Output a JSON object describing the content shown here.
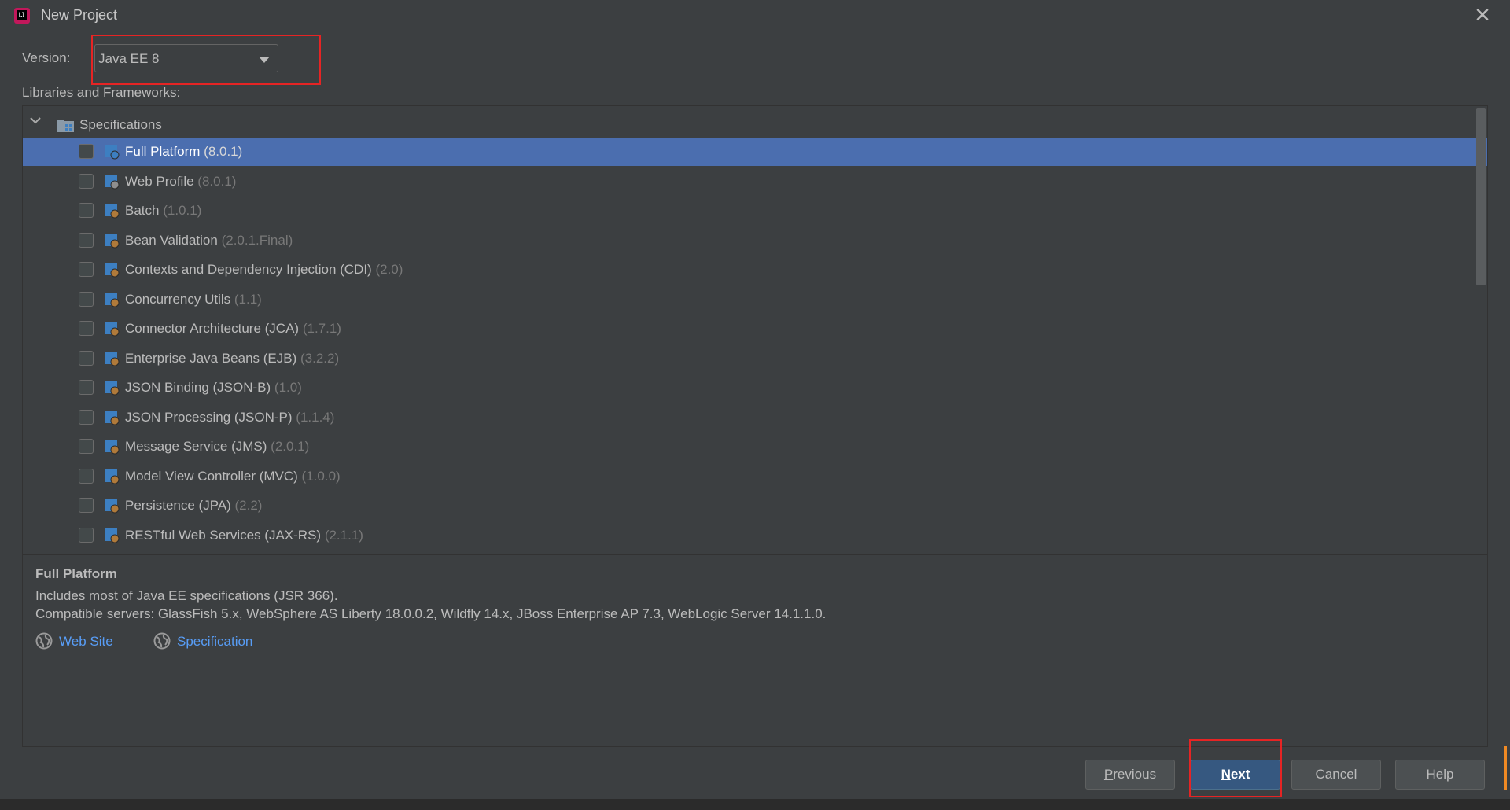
{
  "window": {
    "title": "New Project",
    "close_glyph": "✕"
  },
  "version": {
    "label": "Version:",
    "value": "Java EE 8"
  },
  "libraries": {
    "label": "Libraries and Frameworks:",
    "root_label": "Specifications",
    "items": [
      {
        "name": "Full Platform",
        "version": "(8.0.1)",
        "selected": true,
        "checked": false
      },
      {
        "name": "Web Profile",
        "version": "(8.0.1)",
        "selected": false,
        "checked": false
      },
      {
        "name": "Batch",
        "version": "(1.0.1)",
        "selected": false,
        "checked": false
      },
      {
        "name": "Bean Validation",
        "version": "(2.0.1.Final)",
        "selected": false,
        "checked": false
      },
      {
        "name": "Contexts and Dependency Injection (CDI)",
        "version": "(2.0)",
        "selected": false,
        "checked": false
      },
      {
        "name": "Concurrency Utils",
        "version": "(1.1)",
        "selected": false,
        "checked": false
      },
      {
        "name": "Connector Architecture (JCA)",
        "version": "(1.7.1)",
        "selected": false,
        "checked": false
      },
      {
        "name": "Enterprise Java Beans (EJB)",
        "version": "(3.2.2)",
        "selected": false,
        "checked": false
      },
      {
        "name": "JSON Binding (JSON-B)",
        "version": "(1.0)",
        "selected": false,
        "checked": false
      },
      {
        "name": "JSON Processing (JSON-P)",
        "version": "(1.1.4)",
        "selected": false,
        "checked": false
      },
      {
        "name": "Message Service (JMS)",
        "version": "(2.0.1)",
        "selected": false,
        "checked": false
      },
      {
        "name": "Model View Controller (MVC)",
        "version": "(1.0.0)",
        "selected": false,
        "checked": false
      },
      {
        "name": "Persistence (JPA)",
        "version": "(2.2)",
        "selected": false,
        "checked": false
      },
      {
        "name": "RESTful Web Services (JAX-RS)",
        "version": "(2.1.1)",
        "selected": false,
        "checked": false
      }
    ]
  },
  "description": {
    "title": "Full Platform",
    "line1": "Includes most of Java EE specifications (JSR 366).",
    "line2": "Compatible servers: GlassFish 5.x, WebSphere AS Liberty 18.0.0.2, Wildfly 14.x, JBoss Enterprise AP 7.3, WebLogic Server 14.1.1.0.",
    "links": [
      "Web Site",
      "Specification"
    ]
  },
  "buttons": {
    "previous_mnemonic": "P",
    "previous_rest": "revious",
    "next_mnemonic": "N",
    "next_rest": "ext",
    "cancel": "Cancel",
    "help": "Help"
  },
  "colors": {
    "background": "#3c3f41",
    "selection": "#4b6eaf",
    "link": "#589df6",
    "primary_button": "#365880",
    "highlight": "#e62424"
  }
}
